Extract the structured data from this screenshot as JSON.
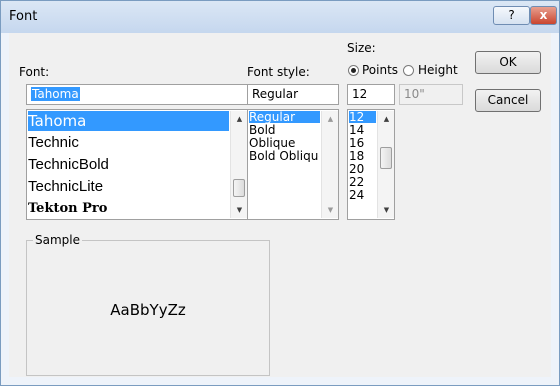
{
  "window": {
    "title": "Font",
    "help_label": "?",
    "close_label": "x"
  },
  "font": {
    "label": "Font:",
    "value": "Tahoma",
    "items": [
      "Tahoma",
      "Technic",
      "TechnicBold",
      "TechnicLite",
      "Tekton Pro"
    ]
  },
  "style": {
    "label": "Font style:",
    "value": "Regular",
    "items": [
      "Regular",
      "Bold",
      "Oblique",
      "Bold Oblique"
    ]
  },
  "size": {
    "label": "Size:",
    "points_label": "Points",
    "height_label": "Height",
    "selected_unit": "Points",
    "value": "12",
    "height_value": "10\"",
    "items": [
      "12",
      "14",
      "16",
      "18",
      "20",
      "22",
      "24"
    ]
  },
  "buttons": {
    "ok": "OK",
    "cancel": "Cancel"
  },
  "sample": {
    "label": "Sample",
    "text": "AaBbYyZz"
  },
  "icons": {
    "help": "help-icon",
    "close": "close-icon"
  }
}
